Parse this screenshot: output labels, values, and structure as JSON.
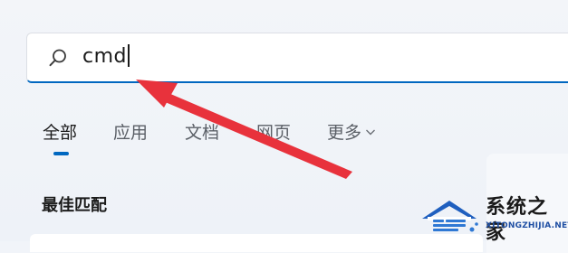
{
  "search": {
    "query": "cmd",
    "icon": "search-icon"
  },
  "tabs": [
    {
      "label": "全部",
      "active": true
    },
    {
      "label": "应用",
      "active": false
    },
    {
      "label": "文档",
      "active": false
    },
    {
      "label": "网页",
      "active": false
    },
    {
      "label": "更多",
      "active": false,
      "icon": "chevron-down-icon"
    }
  ],
  "section": {
    "heading": "最佳匹配"
  },
  "watermark": {
    "title": "系统之家",
    "subtitle": "XITONGZHIJIA.NET"
  },
  "colors": {
    "accent": "#0067c0",
    "arrow": "#e8323c"
  }
}
